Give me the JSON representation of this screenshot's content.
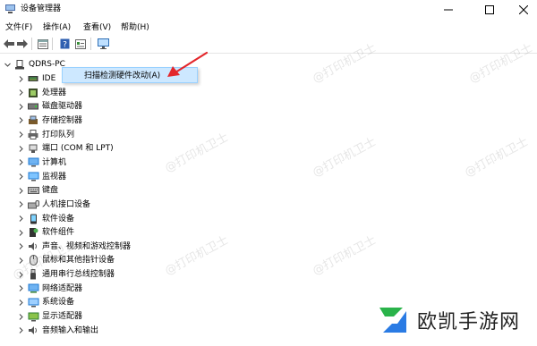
{
  "window": {
    "title": "设备管理器"
  },
  "menubar": {
    "items": [
      "文件(F)",
      "操作(A)",
      "查看(V)",
      "帮助(H)"
    ]
  },
  "tree": {
    "root": "QDRS-PC",
    "items": [
      {
        "label": "IDE",
        "icon": "ide-controller-icon"
      },
      {
        "label": "处理器",
        "icon": "processor-icon"
      },
      {
        "label": "磁盘驱动器",
        "icon": "disk-drive-icon"
      },
      {
        "label": "存储控制器",
        "icon": "storage-controller-icon"
      },
      {
        "label": "打印队列",
        "icon": "printer-icon"
      },
      {
        "label": "端口 (COM 和 LPT)",
        "icon": "port-icon"
      },
      {
        "label": "计算机",
        "icon": "computer-icon"
      },
      {
        "label": "监视器",
        "icon": "monitor-icon"
      },
      {
        "label": "键盘",
        "icon": "keyboard-icon"
      },
      {
        "label": "人机接口设备",
        "icon": "hid-icon"
      },
      {
        "label": "软件设备",
        "icon": "software-device-icon"
      },
      {
        "label": "软件组件",
        "icon": "software-component-icon"
      },
      {
        "label": "声音、视频和游戏控制器",
        "icon": "sound-icon"
      },
      {
        "label": "鼠标和其他指针设备",
        "icon": "mouse-icon"
      },
      {
        "label": "通用串行总线控制器",
        "icon": "usb-icon"
      },
      {
        "label": "网络适配器",
        "icon": "network-adapter-icon"
      },
      {
        "label": "系统设备",
        "icon": "system-device-icon"
      },
      {
        "label": "显示适配器",
        "icon": "display-adapter-icon"
      },
      {
        "label": "音频输入和输出",
        "icon": "audio-io-icon"
      }
    ]
  },
  "context_menu": {
    "item": "扫描检测硬件改动(A)"
  },
  "watermark": "@打印机卫士",
  "brand": {
    "text": "欧凯手游网"
  },
  "colors": {
    "highlight": "#cde8ff",
    "highlight_border": "#99d1ff",
    "arrow": "#e3262b",
    "brand_green": "#2ab34a",
    "brand_blue": "#2a7be4"
  }
}
